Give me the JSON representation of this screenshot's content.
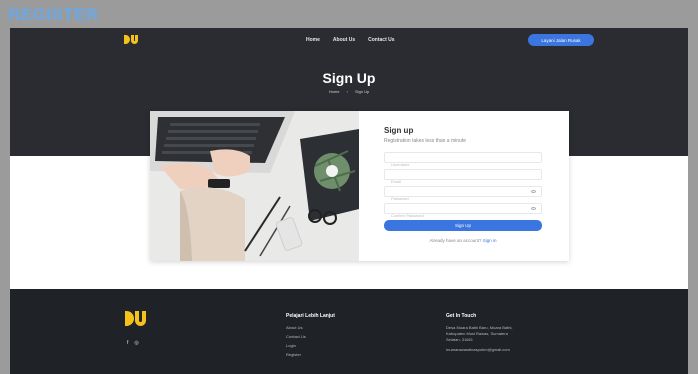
{
  "window": {
    "title": "REGISTER"
  },
  "header": {
    "nav": [
      "Home",
      "About Us",
      "Contact Us"
    ],
    "cta_label": "Layani Jalan Rusak"
  },
  "hero": {
    "title": "Sign Up",
    "breadcrumb": [
      "Home",
      "›",
      "Sign Up"
    ]
  },
  "form": {
    "title": "Sign up",
    "subtitle": "Registration takes less than a minute",
    "fields": {
      "username": "Username",
      "email": "Email",
      "password": "Password",
      "confirm": "Confirm Password"
    },
    "submit_label": "Sign Up",
    "signin_prefix": "Already have an account?",
    "signin_link": "Sign in"
  },
  "footer": {
    "social": [
      "f",
      "◎"
    ],
    "col1": {
      "title": "Pelajari Lebih Lanjut",
      "items": [
        "About Us",
        "Contact Us",
        "Login",
        "Register"
      ]
    },
    "col2": {
      "title": "Get In Touch",
      "address": [
        "Desa Muara Bathi Baru, Muara Bathi,",
        "Kabupaten Musi Rawas, Sumatera",
        "Selatan, 31661"
      ],
      "email": "muararawasdinaspuhm@gmail.com"
    }
  },
  "colors": {
    "accent": "#3b75df",
    "logo": "#f4c21a",
    "dark": "#2a2c31"
  }
}
